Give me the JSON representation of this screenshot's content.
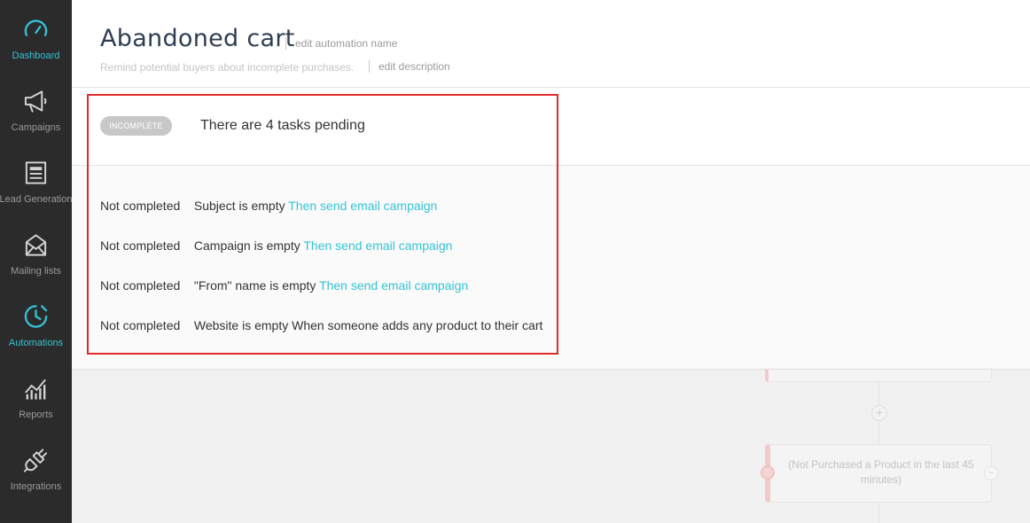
{
  "sidebar": {
    "items": [
      {
        "label": "Dashboard",
        "icon": "gauge-icon"
      },
      {
        "label": "Campaigns",
        "icon": "megaphone-icon"
      },
      {
        "label": "Lead Generation",
        "icon": "form-icon"
      },
      {
        "label": "Mailing lists",
        "icon": "envelope-icon"
      },
      {
        "label": "Automations",
        "icon": "timer-icon"
      },
      {
        "label": "Reports",
        "icon": "chart-icon"
      },
      {
        "label": "Integrations",
        "icon": "plug-icon"
      }
    ],
    "active_color": "#34c3d6"
  },
  "header": {
    "title": "Abandoned cart",
    "edit_name": "edit automation name",
    "description": "Remind potential buyers about incomplete purchases.",
    "edit_description": "edit description"
  },
  "status": {
    "badge": "INCOMPLETE",
    "message": "There are 4 tasks pending"
  },
  "tasks": [
    {
      "state": "Not completed",
      "text": "Subject is empty",
      "link": "Then send email campaign"
    },
    {
      "state": "Not completed",
      "text": "Campaign is empty",
      "link": "Then send email campaign"
    },
    {
      "state": "Not completed",
      "text": "\"From\" name is empty",
      "link": "Then send email campaign"
    },
    {
      "state": "Not completed",
      "text": "Website is empty When someone adds any product to their cart",
      "link": ""
    }
  ],
  "flow": {
    "plus_symbol": "+",
    "minus_symbol": "−",
    "condition_text": "(Not Purchased a Product in the last 45 minutes)"
  },
  "colors": {
    "accent": "#34c3d6",
    "highlight": "#e12b2b",
    "sidebar_bg": "#2b2b2b"
  }
}
